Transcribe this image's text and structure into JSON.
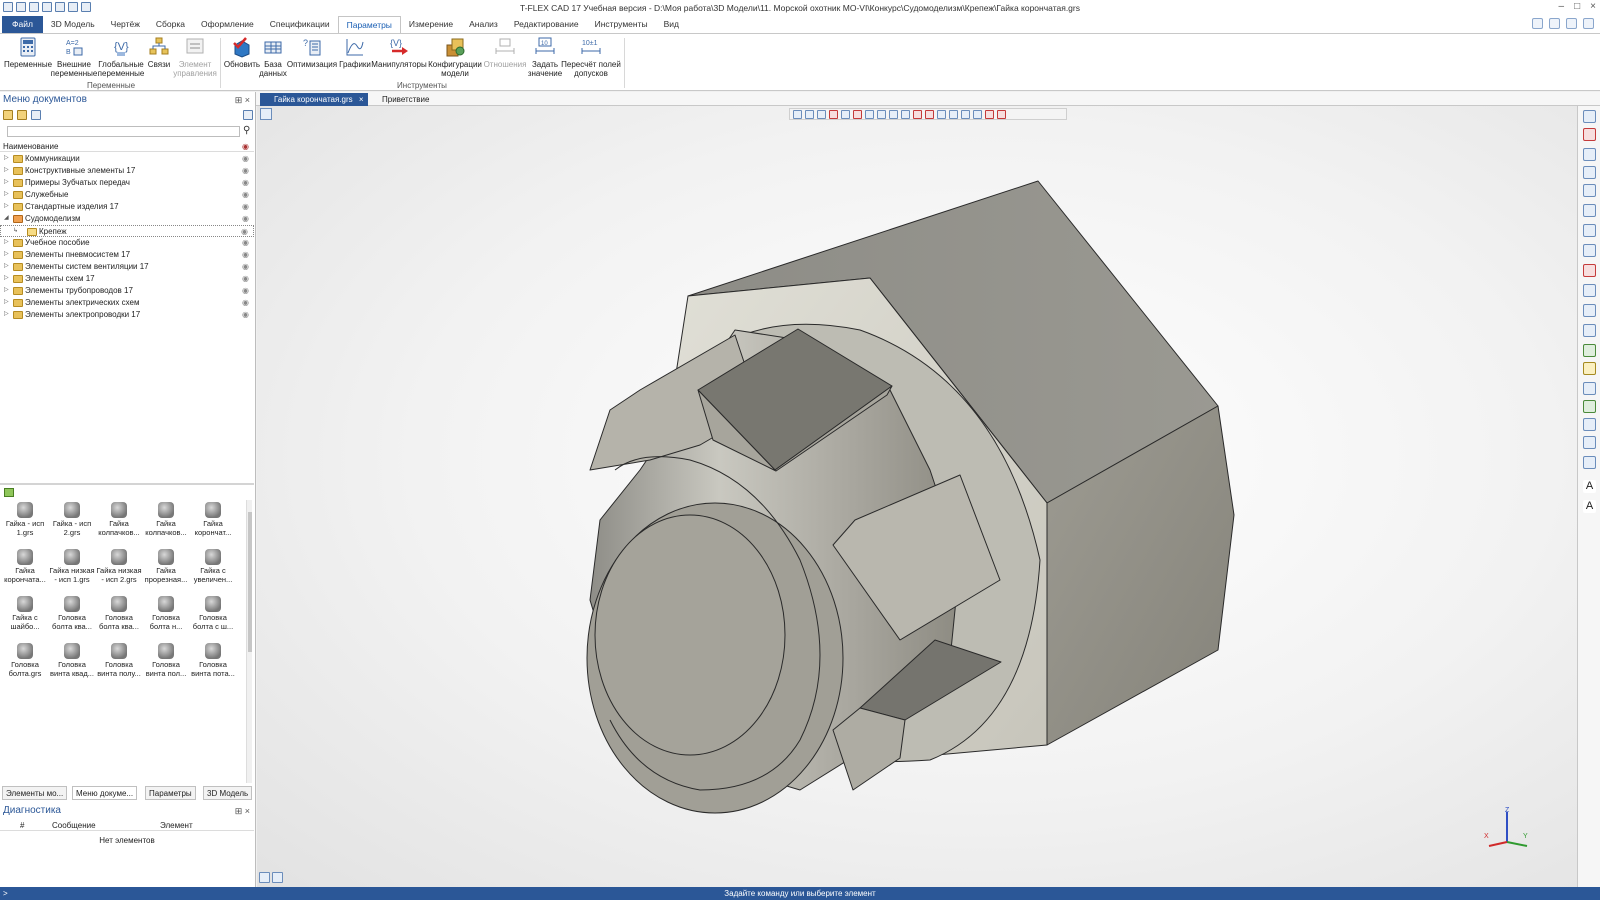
{
  "window": {
    "title": "T-FLEX CAD 17 Учебная версия - D:\\Моя работа\\3D Модели\\11. Морской охотник МО-VI\\Конкурс\\Судомоделизм\\Крепеж\\Гайка корончатая.grs"
  },
  "menu": {
    "items": [
      "Файл",
      "3D Модель",
      "Чертёж",
      "Сборка",
      "Оформление",
      "Спецификации",
      "Параметры",
      "Измерение",
      "Анализ",
      "Редактирование",
      "Инструменты",
      "Вид"
    ],
    "active": "Параметры"
  },
  "ribbon": {
    "buttons": {
      "variables": "Переменные",
      "external_vars": "Внешние переменные",
      "global_vars": "Глобальные переменные",
      "links": "Связи",
      "control_element": "Элемент управления",
      "update": "Обновить",
      "database": "База данных",
      "optimization": "Оптимизация",
      "graphs": "Графики",
      "manipulators": "Манипуляторы",
      "model_configs": "Конфигурации модели",
      "relations": "Отношения",
      "set_value": "Задать значение",
      "recalc_tolerances": "Пересчёт полей допусков"
    },
    "groups": {
      "variables": "Переменные",
      "tools": "Инструменты"
    }
  },
  "doc_menu": {
    "title": "Меню документов",
    "column_header": "Наименование",
    "tree": [
      "Коммуникации",
      "Конструктивные элементы 17",
      "Примеры Зубчатых передач",
      "Служебные",
      "Стандартные изделия 17",
      "Судомоделизм",
      "Крепеж",
      "Учебное пособие",
      "Элементы пневмосистем 17",
      "Элементы систем вентиляции 17",
      "Элементы схем 17",
      "Элементы трубопроводов 17",
      "Элементы электрических схем",
      "Элементы электропроводки 17"
    ],
    "selected": "Крепеж",
    "thumbnails": [
      "Гайка - исп 1.grs",
      "Гайка - исп 2.grs",
      "Гайка колпачков...",
      "Гайка колпачков...",
      "Гайка корончат...",
      "Гайка корончата...",
      "Гайка низкая - исп 1.grs",
      "Гайка низкая - исп 2.grs",
      "Гайка прорезная...",
      "Гайка с увеличен...",
      "Гайка с шайбо...",
      "Головка болта ква...",
      "Головка болта ква...",
      "Головка болта н...",
      "Головка болта с ш...",
      "Головка болта.grs",
      "Головка винта квад...",
      "Головка винта полу...",
      "Головка винта пол...",
      "Головка винта пота..."
    ]
  },
  "bottom_tabs": [
    "Элементы мо...",
    "Меню докуме...",
    "Параметры",
    "3D Модель"
  ],
  "diagnostics": {
    "title": "Диагностика",
    "columns": [
      "#",
      "Сообщение",
      "Элемент"
    ],
    "empty_text": "Нет элементов"
  },
  "doc_tabs": [
    "Гайка корончатая.grs",
    "Приветствие"
  ],
  "status": {
    "left": ">",
    "message": "Задайте команду или выберите элемент"
  },
  "colors": {
    "accent": "#2b5797",
    "model_face": "#9a988f"
  }
}
